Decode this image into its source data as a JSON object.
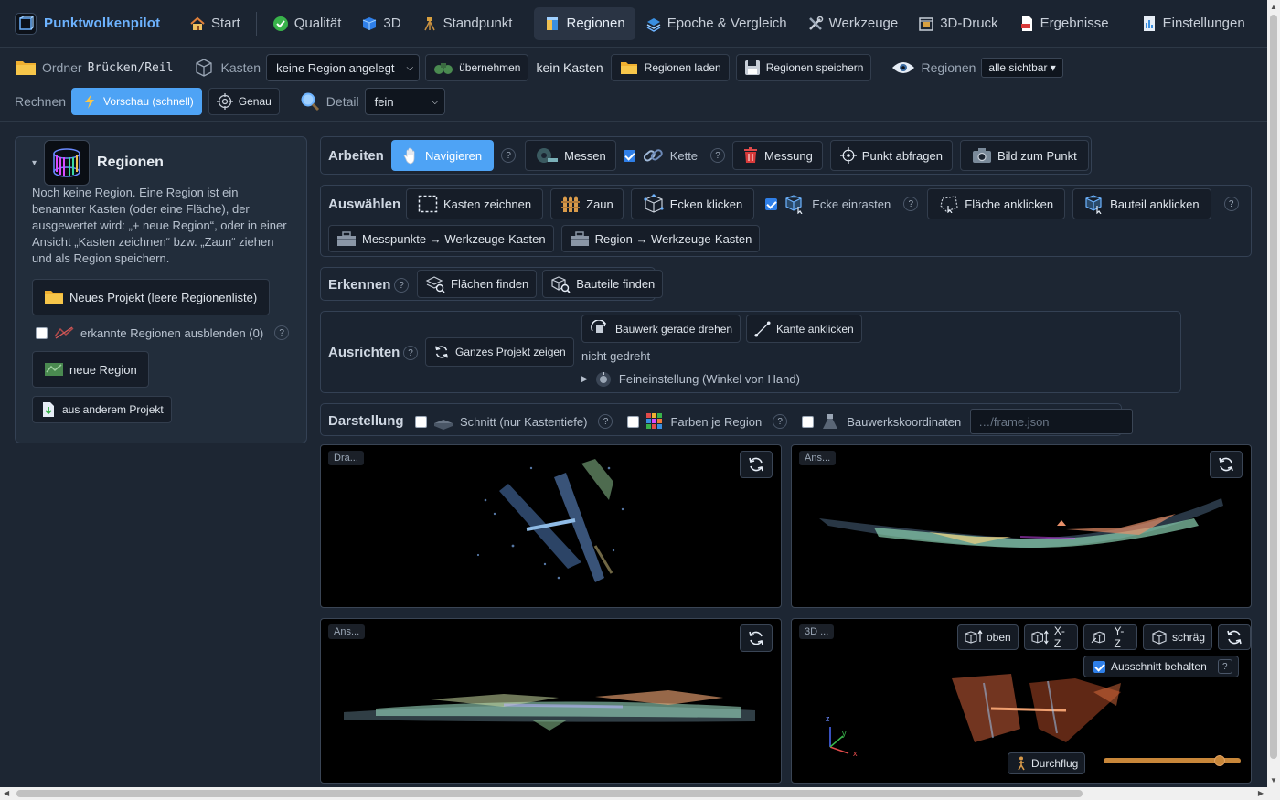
{
  "app": {
    "brand": "Punktwolkenpilot"
  },
  "nav": {
    "items": [
      {
        "label": "Start",
        "icon": "house-icon"
      },
      {
        "label": "Qualität",
        "icon": "check-circle-icon"
      },
      {
        "label": "3D",
        "icon": "cube-icon"
      },
      {
        "label": "Standpunkt",
        "icon": "tripod-icon"
      },
      {
        "label": "Regionen",
        "icon": "box-region-icon",
        "active": true
      },
      {
        "label": "Epoche & Vergleich",
        "icon": "layers-icon"
      },
      {
        "label": "Werkzeuge",
        "icon": "tools-icon"
      },
      {
        "label": "3D-Druck",
        "icon": "printer-icon"
      },
      {
        "label": "Ergebnisse",
        "icon": "pdf-icon"
      },
      {
        "label": "Einstellungen",
        "icon": "settings-doc-icon"
      }
    ]
  },
  "toolbar": {
    "ordner_label": "Ordner",
    "ordner_value": "Brücken/Reil",
    "kasten_label": "Kasten",
    "kasten_select": "keine Region angelegt",
    "uebernehmen": "übernehmen",
    "kein_kasten": "kein Kasten",
    "regionen_laden": "Regionen laden",
    "regionen_speichern": "Regionen speichern",
    "regionen_label": "Regionen",
    "regionen_visibility": "alle sichtbar ▾",
    "rechnen_label": "Rechnen",
    "vorschau": "Vorschau (schnell)",
    "genau": "Genau",
    "detail_label": "Detail",
    "detail_select": "fein"
  },
  "panel": {
    "title": "Regionen",
    "description": "Noch keine Region. Eine Region ist ein benannter Kasten (oder eine Fläche), der ausgewertet wird: „+ neue Region“, oder in einer Ansicht „Kasten zeichnen“ bzw. „Zaun“ ziehen und als Region speichern.",
    "new_project": "Neues Projekt (leere Regionenliste)",
    "hide_detected": "erkannte Regionen ausblenden (0)",
    "new_region": "neue Region",
    "from_project": "aus anderem Projekt",
    "help": "?"
  },
  "arbeiten": {
    "label": "Arbeiten",
    "navigieren": "Navigieren",
    "messen": "Messen",
    "kette": "Kette",
    "kette_checked": true,
    "messung": "Messung",
    "punkt_abfragen": "Punkt abfragen",
    "bild_zum_punkt": "Bild zum Punkt"
  },
  "auswaehlen": {
    "label": "Auswählen",
    "kasten_zeichnen": "Kasten zeichnen",
    "zaun": "Zaun",
    "ecken_klicken": "Ecken klicken",
    "ecke_einrasten": "Ecke einrasten",
    "ecke_checked": true,
    "flaeche_anklicken": "Fläche anklicken",
    "bauteil_anklicken": "Bauteil anklicken",
    "messpunkte_kasten": "Messpunkte → Werkzeuge-Kasten",
    "region_kasten": "Region → Werkzeuge-Kasten"
  },
  "erkennen": {
    "label": "Erkennen",
    "flaechen_finden": "Flächen finden",
    "bauteile_finden": "Bauteile finden"
  },
  "ausrichten": {
    "label": "Ausrichten",
    "ganzes_projekt": "Ganzes Projekt zeigen",
    "bauwerk_gerade": "Bauwerk gerade drehen",
    "kante_anklicken": "Kante anklicken",
    "status": "nicht gedreht",
    "feineinstellung": "Feineinstellung (Winkel von Hand)"
  },
  "darstellung": {
    "label": "Darstellung",
    "schnitt": "Schnitt (nur Kastentiefe)",
    "farben": "Farben je Region",
    "koordinaten": "Bauwerkskoordinaten",
    "frame_placeholder": "…/frame.json"
  },
  "viewports": {
    "top_left_tag": "Dra...",
    "top_right_tag": "Ans...",
    "bottom_left_tag": "Ans...",
    "bottom_right_tag": "3D ...",
    "btn_oben": "oben",
    "btn_xz": "X-Z",
    "btn_yz": "Y-Z",
    "btn_schraeg": "schräg",
    "ausschnitt": "Ausschnitt behalten",
    "ausschnitt_checked": true,
    "durchflug": "Durchflug",
    "durchflug_level": 0.88,
    "axis_z": "z",
    "axis_y": "y",
    "axis_x": "x"
  },
  "colors": {
    "accent": "#4ea3f5",
    "brand": "#6db3ff",
    "background": "#1d2633",
    "slider": "#c8873a"
  }
}
